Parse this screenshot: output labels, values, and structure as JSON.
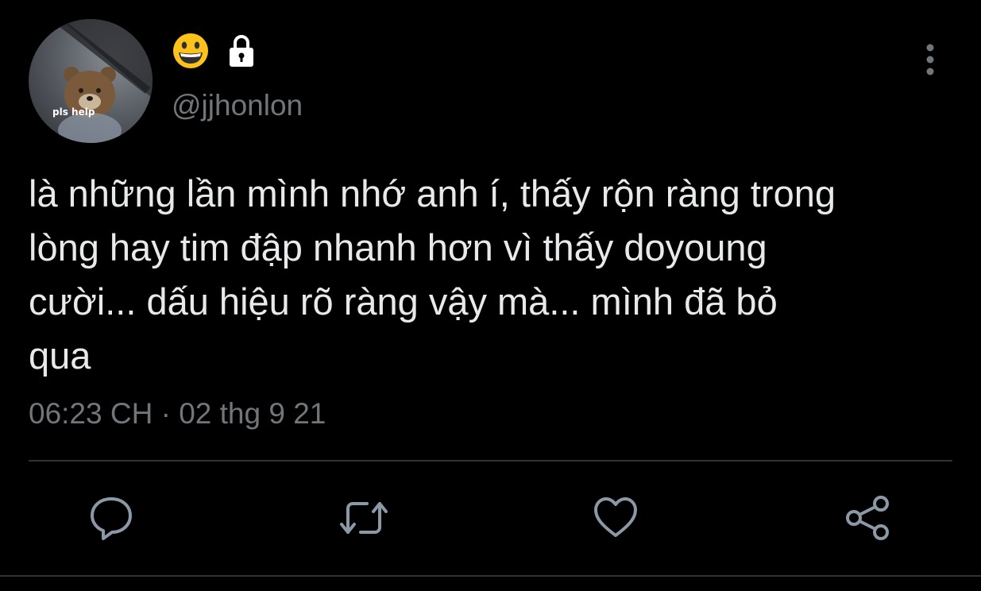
{
  "profile": {
    "avatar_text": "pls help",
    "name_icons": [
      "grinning-face-emoji-icon",
      "lock-icon"
    ],
    "handle": "@jjhonlon"
  },
  "tweet": {
    "text": "là những lần mình nhớ anh í, thấy rộn ràng trong\nlòng hay tim đập nhanh hơn vì thấy doyoung\ncười... dấu hiệu rõ ràng vậy mà... mình đã bỏ\nqua",
    "timestamp": "06:23 CH · 02 thg 9 21"
  },
  "actions": [
    "reply-icon",
    "retweet-icon",
    "like-icon",
    "share-icon"
  ],
  "colors": {
    "background": "#000000",
    "text": "#e7e9ea",
    "secondary": "#71767b",
    "divider": "#2f3336"
  }
}
